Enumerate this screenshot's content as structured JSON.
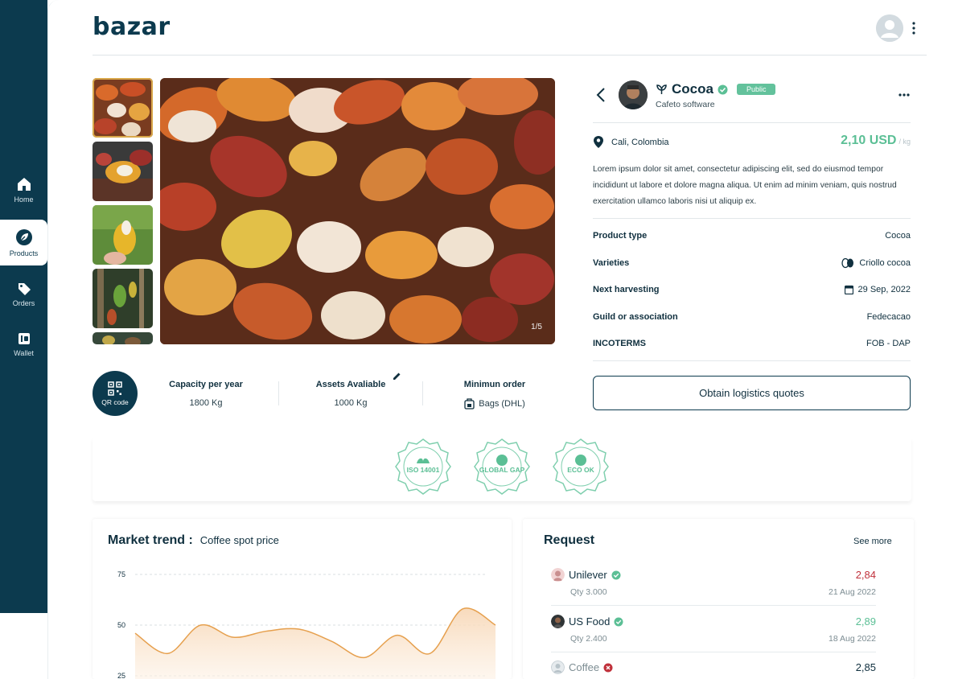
{
  "sidebar": {
    "items": [
      {
        "label": "Home",
        "icon": "home-icon"
      },
      {
        "label": "Products",
        "icon": "leaf-icon",
        "active": true
      },
      {
        "label": "Orders",
        "icon": "tag-icon"
      },
      {
        "label": "Wallet",
        "icon": "wallet-icon"
      }
    ]
  },
  "header": {
    "logo": "bazar"
  },
  "gallery": {
    "counter": "1/5",
    "thumbnail_count": 5
  },
  "stats": {
    "qr_label": "QR code",
    "capacity_title": "Capacity per year",
    "capacity_value": "1800 Kg",
    "assets_title": "Assets Avaliable",
    "assets_value": "1000 Kg",
    "min_order_title": "Minimun order",
    "min_order_value": "Bags (DHL)"
  },
  "certifications": [
    "ISO 14001",
    "GLOBAL GAP",
    "ECO OK"
  ],
  "product": {
    "name": "Cocoa",
    "visibility": "Public",
    "seller": "Cafeto software",
    "location": "Cali, Colombia",
    "price": "2,10 USD",
    "price_unit": "/ kg",
    "description": "Lorem ipsum dolor sit amet, consectetur adipiscing elit, sed do eiusmod tempor incididunt ut labore et dolore magna aliqua. Ut enim ad minim veniam, quis nostrud exercitation ullamco laboris nisi ut aliquip ex.",
    "specs": [
      {
        "key": "Product type",
        "value": "Cocoa"
      },
      {
        "key": "Varieties",
        "value": "Criollo cocoa"
      },
      {
        "key": "Next harvesting",
        "value": "29 Sep, 2022"
      },
      {
        "key": "Guild or association",
        "value": "Fedecacao"
      },
      {
        "key": "INCOTERMS",
        "value": "FOB - DAP"
      }
    ],
    "logistics_button": "Obtain logistics quotes"
  },
  "market": {
    "title": "Market trend :",
    "subtitle": "Coffee spot price",
    "chart_data": {
      "type": "area",
      "title": "Coffee spot price",
      "ylim": [
        25,
        75
      ],
      "y_ticks": [
        "75",
        "50",
        "25"
      ],
      "series": [
        {
          "values": [
            46,
            36,
            50,
            44,
            47,
            48,
            42,
            34,
            45,
            36,
            58,
            50
          ]
        }
      ],
      "grid": true,
      "color": "#e6a04e"
    }
  },
  "requests": {
    "title": "Request",
    "see_more": "See more",
    "items": [
      {
        "name": "Unilever",
        "status": "verified",
        "price": "2,84",
        "price_color": "#c0313b",
        "qty": "Qty 3.000",
        "date": "21 Aug 2022"
      },
      {
        "name": "US Food",
        "status": "verified",
        "price": "2,89",
        "price_color": "#5bbf95",
        "qty": "Qty 2.400",
        "date": "18 Aug 2022"
      },
      {
        "name": "Coffee",
        "status": "rejected",
        "price": "2,85",
        "price_color": "#10303f"
      }
    ]
  },
  "colors": {
    "brand": "#0c3a4e",
    "accent": "#5bbf95",
    "negative": "#c0313b"
  }
}
